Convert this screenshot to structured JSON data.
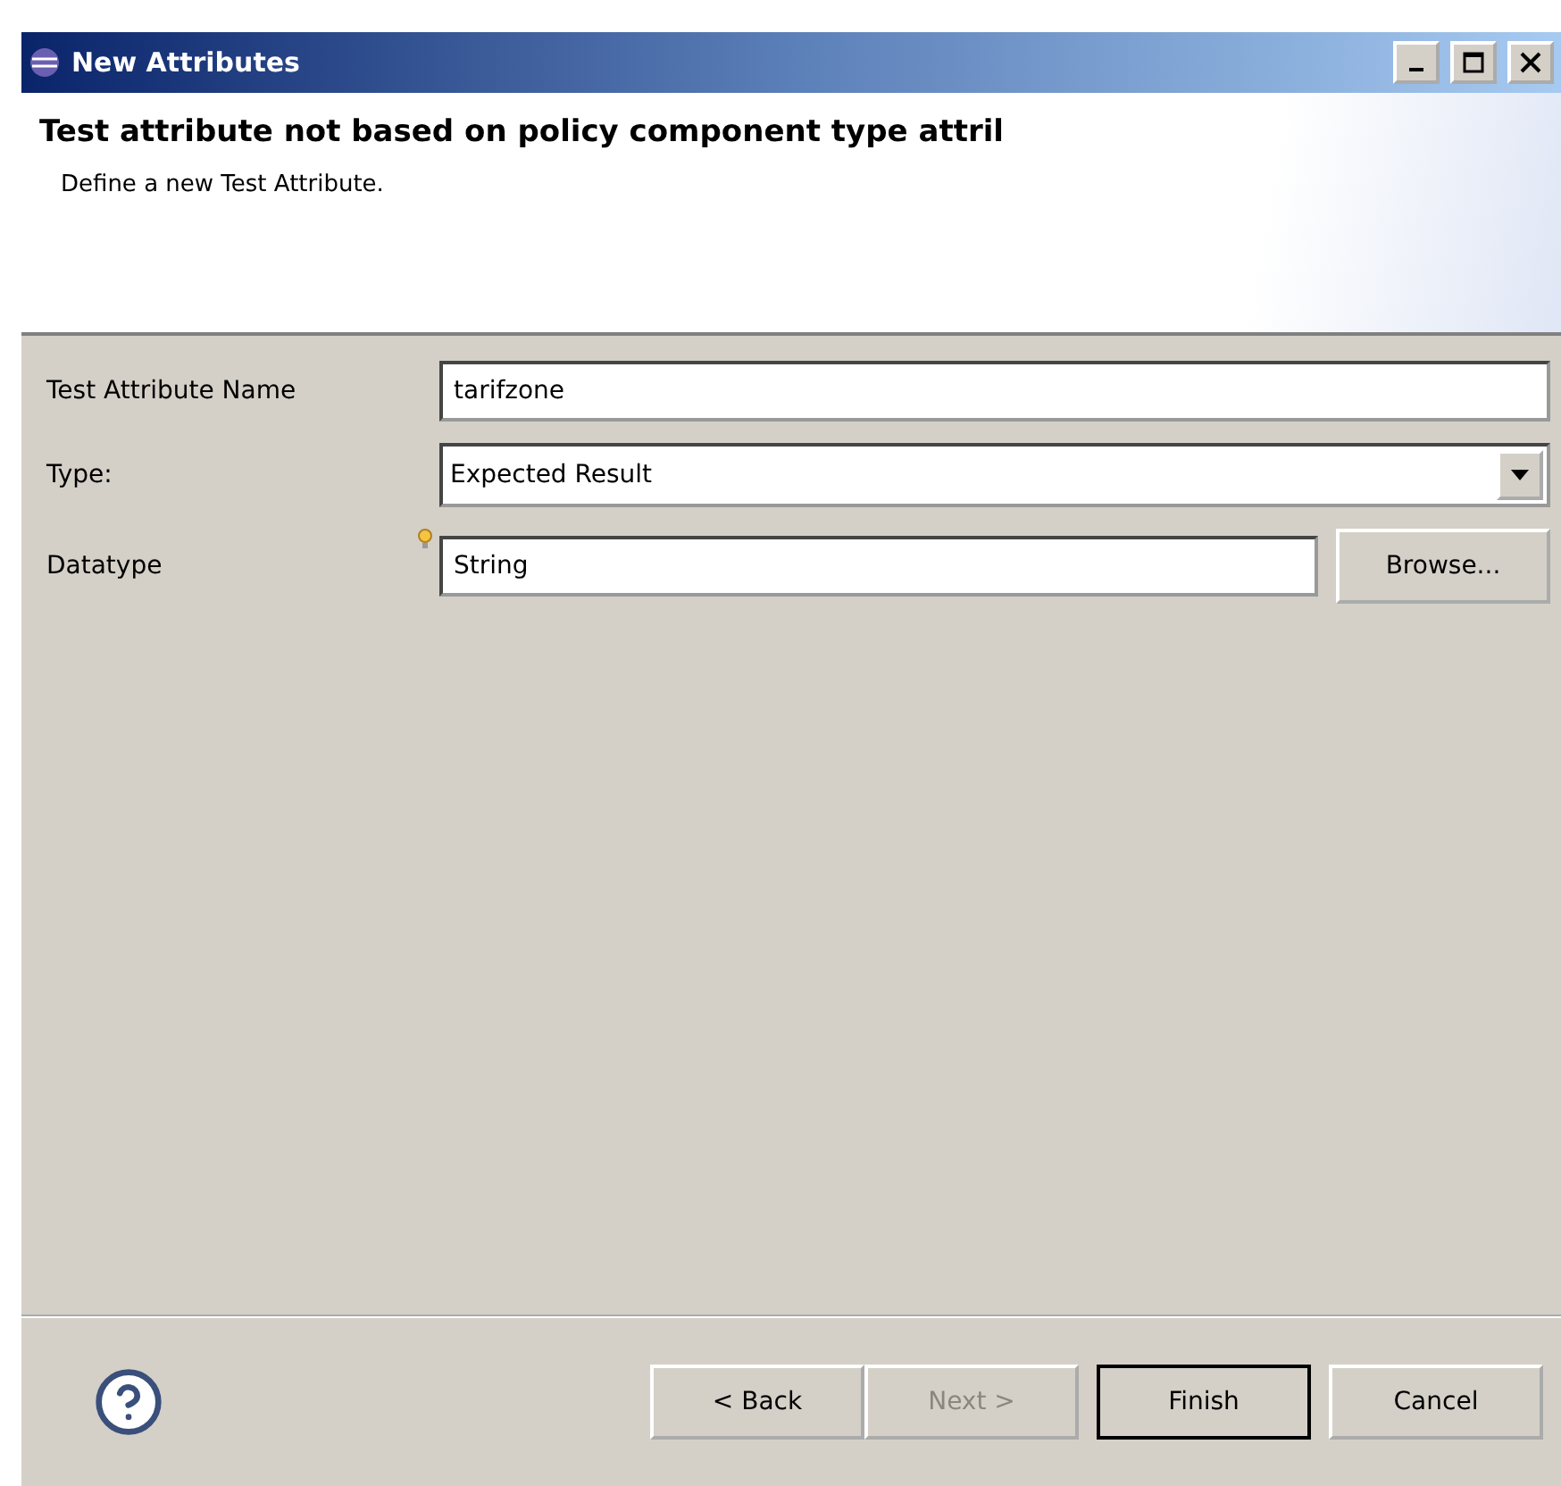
{
  "window": {
    "title": "New Attributes"
  },
  "header": {
    "title": "Test attribute not based on policy component type attril",
    "description": "Define a new Test Attribute."
  },
  "fields": [
    {
      "kind": "text",
      "label": "Test Attribute Name",
      "value": "tarifzone"
    },
    {
      "kind": "combo",
      "label": "Type:",
      "value": "Expected Result"
    },
    {
      "kind": "browse",
      "label": "Datatype",
      "value": "String",
      "button": "Browse...",
      "hint": true
    }
  ],
  "buttons": [
    {
      "label": "< Back",
      "disabled": false,
      "default": false
    },
    {
      "label": "Next >",
      "disabled": true,
      "default": false
    },
    {
      "label": "Finish",
      "disabled": false,
      "default": true
    },
    {
      "label": "Cancel",
      "disabled": false,
      "default": false
    }
  ]
}
